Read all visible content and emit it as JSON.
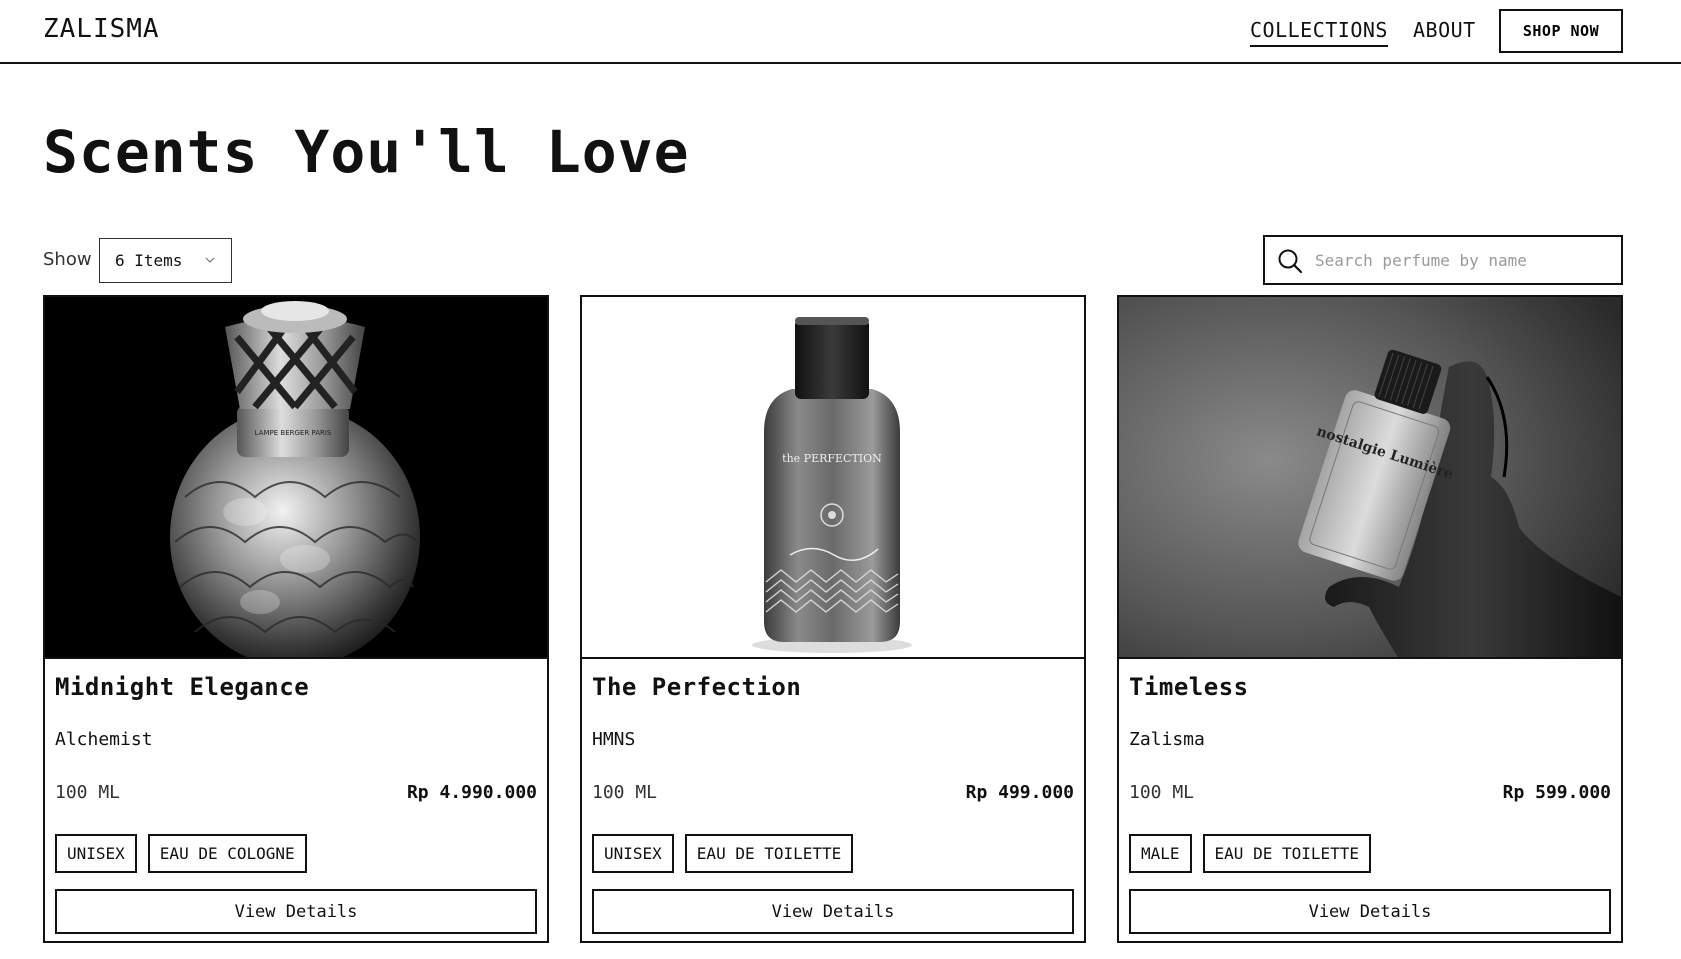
{
  "header": {
    "logo": "ZALISMA",
    "nav": [
      {
        "label": "COLLECTIONS",
        "active": true
      },
      {
        "label": "ABOUT",
        "active": false
      }
    ],
    "cta_label": "SHOP NOW"
  },
  "page_title": "Scents You'll Love",
  "controls": {
    "show_label": "Show",
    "show_value": "6 Items",
    "search_placeholder": "Search perfume by name",
    "search_value": ""
  },
  "products": [
    {
      "name": "Midnight Elegance",
      "brand": "Alchemist",
      "volume": "100 ML",
      "price": "Rp 4.990.000",
      "tags": [
        "UNISEX",
        "EAU DE COLOGNE"
      ],
      "button_label": "View Details",
      "image": "perfume-lamp-bottle-image",
      "image_text": "LAMPE BERGER PARIS"
    },
    {
      "name": "The Perfection",
      "brand": "HMNS",
      "volume": "100 ML",
      "price": "Rp 499.000",
      "tags": [
        "UNISEX",
        "EAU DE TOILETTE"
      ],
      "button_label": "View Details",
      "image": "perfume-bottle-image",
      "image_text": "the PERFECTION"
    },
    {
      "name": "Timeless",
      "brand": "Zalisma",
      "volume": "100 ML",
      "price": "Rp 599.000",
      "tags": [
        "MALE",
        "EAU DE TOILETTE"
      ],
      "button_label": "View Details",
      "image": "hand-holding-perfume-image",
      "image_text": "nostalgie Lumière"
    }
  ],
  "colors": {
    "ink": "#111111",
    "background": "#ffffff",
    "placeholder": "#9a9a9a"
  }
}
